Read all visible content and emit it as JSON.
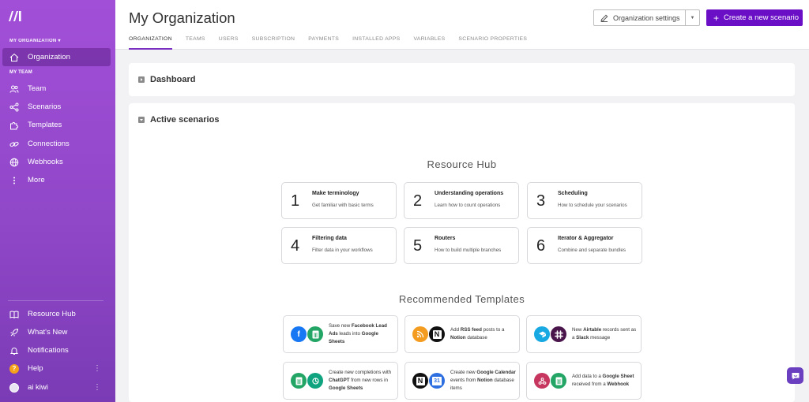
{
  "sidebar": {
    "org_label": "MY ORGANIZATION",
    "team_label": "MY TEAM",
    "top_items": [
      {
        "label": "Organization",
        "icon": "home-icon"
      },
      {
        "label": "Team",
        "icon": "users-icon"
      },
      {
        "label": "Scenarios",
        "icon": "share-icon"
      },
      {
        "label": "Templates",
        "icon": "puzzle-icon"
      },
      {
        "label": "Connections",
        "icon": "link-icon"
      },
      {
        "label": "Webhooks",
        "icon": "globe-icon"
      },
      {
        "label": "More",
        "icon": "more-vertical-icon"
      }
    ],
    "bottom_items": [
      {
        "label": "Resource Hub",
        "icon": "book-icon"
      },
      {
        "label": "What's New",
        "icon": "rocket-icon"
      },
      {
        "label": "Notifications",
        "icon": "bell-icon"
      },
      {
        "label": "Help",
        "icon": "help-icon"
      },
      {
        "label": "ai kiwi",
        "icon": "avatar"
      }
    ]
  },
  "header": {
    "title": "My Organization",
    "tabs": [
      "ORGANIZATION",
      "TEAMS",
      "USERS",
      "SUBSCRIPTION",
      "PAYMENTS",
      "INSTALLED APPS",
      "VARIABLES",
      "SCENARIO PROPERTIES"
    ],
    "settings_label": "Organization settings",
    "create_label": "Create a new scenario"
  },
  "main": {
    "dashboard_label": "Dashboard",
    "active_label": "Active scenarios",
    "resource_hub_title": "Resource Hub",
    "hub_items": [
      {
        "num": "1",
        "title": "Make terminology",
        "sub": "Get familiar with basic terms"
      },
      {
        "num": "2",
        "title": "Understanding operations",
        "sub": "Learn how to count operations"
      },
      {
        "num": "3",
        "title": "Scheduling",
        "sub": "How to schedule your scenarios"
      },
      {
        "num": "4",
        "title": "Filtering data",
        "sub": "Filter data in your workflows"
      },
      {
        "num": "5",
        "title": "Routers",
        "sub": "How to build multiple branches"
      },
      {
        "num": "6",
        "title": "Iterator & Aggregator",
        "sub": "Combine and separate bundles"
      }
    ],
    "templates_title": "Recommended Templates",
    "templates": [
      {
        "parts": [
          "Save new ",
          "Facebook Lead Ads",
          " leads into ",
          "Google Sheets",
          ""
        ],
        "icons": [
          "facebook",
          "sheets"
        ]
      },
      {
        "parts": [
          "Add ",
          "RSS feed",
          " posts to a ",
          "Notion",
          " database"
        ],
        "icons": [
          "rss",
          "notion"
        ]
      },
      {
        "parts": [
          "New ",
          "Airtable",
          " records sent as a ",
          "Slack",
          " message"
        ],
        "icons": [
          "airtable",
          "slack"
        ]
      },
      {
        "parts": [
          "Create new completions with ",
          "ChatGPT",
          " from new rows in ",
          "Google Sheets",
          ""
        ],
        "icons": [
          "sheets",
          "chatgpt"
        ]
      },
      {
        "parts": [
          "Create new ",
          "Google Calendar",
          " events from ",
          "Notion",
          " database items"
        ],
        "icons": [
          "notion",
          "calendar"
        ]
      },
      {
        "parts": [
          "Add data to a ",
          "Google Sheet",
          " received from a ",
          "Webhook",
          ""
        ],
        "icons": [
          "webhook",
          "sheets"
        ]
      }
    ]
  },
  "colors": {
    "sidebar_top": "#a24fd8",
    "sidebar_bottom": "#7a3bb5",
    "primary": "#6a0fc6",
    "tab_underline": "#7b2ec2"
  }
}
